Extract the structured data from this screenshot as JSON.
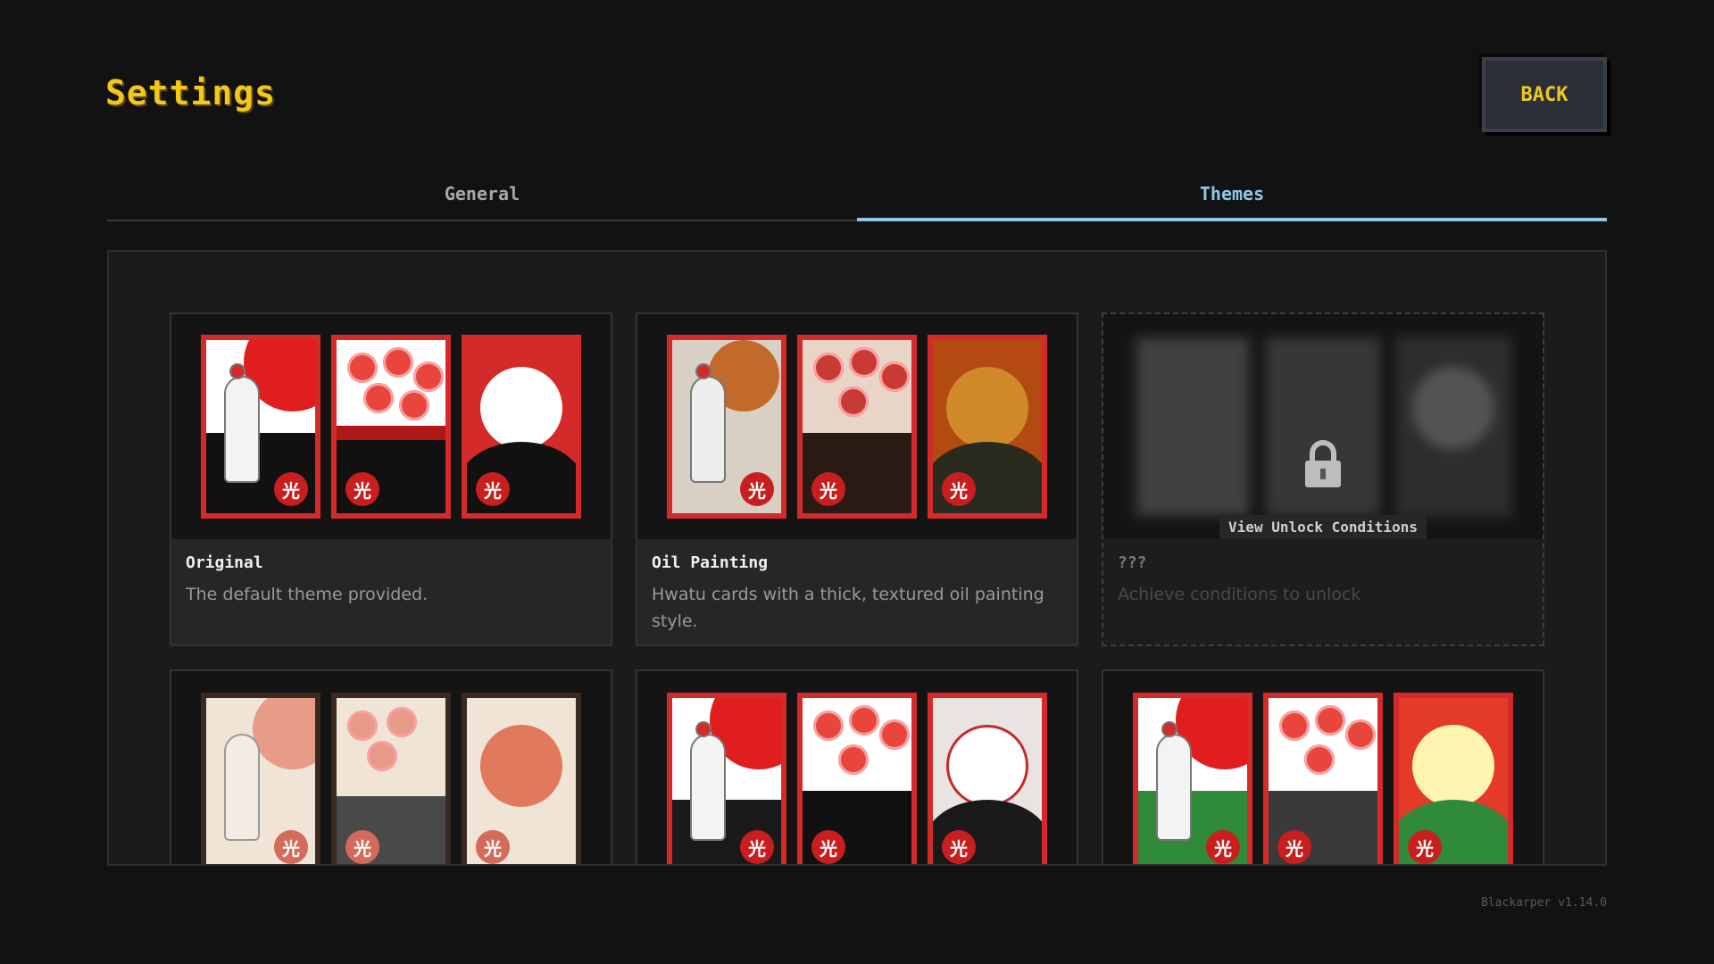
{
  "header": {
    "title": "Settings",
    "back_label": "BACK"
  },
  "tabs": [
    {
      "label": "General",
      "active": false
    },
    {
      "label": "Themes",
      "active": true
    }
  ],
  "themes": [
    {
      "name": "Original",
      "description": "The default theme provided.",
      "style": "original"
    },
    {
      "name": "Oil Painting",
      "description": "Hwatu cards with a thick, textured oil painting style.",
      "style": "oil"
    },
    {
      "name": "???",
      "description": "Achieve conditions to unlock",
      "locked": true,
      "unlock_label": "View Unlock Conditions"
    },
    {
      "name": "",
      "description": "",
      "style": "ink"
    },
    {
      "name": "",
      "description": "",
      "style": "sketch"
    },
    {
      "name": "",
      "description": "",
      "style": "green"
    }
  ],
  "card_badge_glyph": "光",
  "colors": {
    "accent_yellow": "#f2c81b",
    "tab_active": "#8ec8e6",
    "card_red": "#d42a2a",
    "background": "#121212"
  },
  "icons": {
    "lock": "lock-icon"
  },
  "footer": {
    "version": "Blackarper v1.14.0"
  }
}
